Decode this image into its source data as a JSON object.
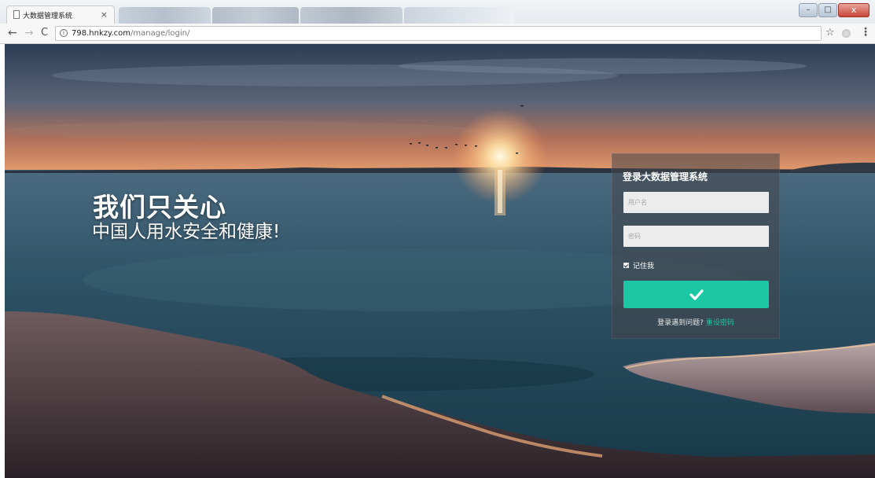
{
  "browser": {
    "tab_title": "大数据管理系统",
    "tab_close": "×",
    "url_host": "798.hnkzy.com",
    "url_path": "/manage/login/",
    "window_close": "x"
  },
  "hero": {
    "title": "我们只关心",
    "subtitle": "中国人用水安全和健康!"
  },
  "login": {
    "title": "登录大数据管理系统",
    "username_placeholder": "用户名",
    "password_placeholder": "密码",
    "remember_label": "记住我",
    "remember_checked": true,
    "help_text": "登录遇到问题?",
    "reset_link": "重设密码"
  },
  "colors": {
    "accent": "#1bc7a5"
  },
  "icons": {
    "back": "arrow-left",
    "forward": "arrow-right",
    "reload": "reload",
    "info": "info-circle",
    "bookmark": "star",
    "menu": "vertical-dots",
    "submit": "checkmark"
  }
}
